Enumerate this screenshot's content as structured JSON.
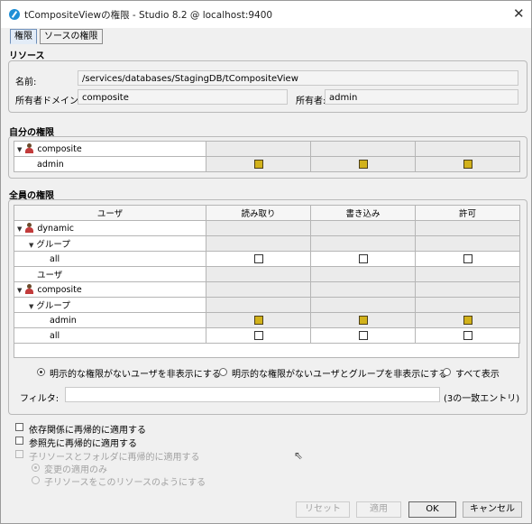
{
  "window": {
    "title": "tCompositeViewの権限 - Studio 8.2 @ localhost:9400"
  },
  "tabs": [
    "権限",
    "ソースの権限"
  ],
  "resource": {
    "section_label": "リソース",
    "name_label": "名前:",
    "name_value": "/services/databases/StagingDB/tCompositeView",
    "domain_label": "所有者ドメイン:",
    "domain_value": "composite",
    "owner_label": "所有者:",
    "owner_value": "admin"
  },
  "my_permissions": {
    "section_label": "自分の権限",
    "group_name": "composite",
    "user_name": "admin"
  },
  "all_permissions": {
    "section_label": "全員の権限",
    "columns": [
      "ユーザ",
      "読み取り",
      "書き込み",
      "許可"
    ],
    "rows": [
      {
        "label": "dynamic",
        "type": "domain"
      },
      {
        "label": "グループ",
        "type": "group-header"
      },
      {
        "label": "all",
        "type": "item",
        "checks": [
          false,
          false,
          false
        ]
      },
      {
        "label": "ユーザ",
        "type": "user-header"
      },
      {
        "label": "composite",
        "type": "domain"
      },
      {
        "label": "グループ",
        "type": "group-header"
      },
      {
        "label": "admin",
        "type": "item",
        "checks": [
          true,
          true,
          true
        ]
      },
      {
        "label": "all",
        "type": "item",
        "checks": [
          false,
          false,
          false
        ]
      }
    ],
    "filter_options": [
      "明示的な権限がないユーザを非表示にする",
      "明示的な権限がないユーザとグループを非表示にする",
      "すべて表示"
    ],
    "selected_filter": 0,
    "filter_label": "フィルタ:",
    "filter_value": "",
    "filter_count": "(3の一致エントリ)"
  },
  "options": {
    "apply_dependencies": "依存関係に再帰的に適用する",
    "apply_references": "参照先に再帰的に適用する",
    "apply_children": "子リソースとフォルダに再帰的に適用する",
    "change_only": "変更の適用のみ",
    "make_like": "子リソースをこのリソースのようにする"
  },
  "buttons": {
    "reset": "リセット",
    "apply": "適用",
    "ok": "OK",
    "cancel": "キャンセル"
  },
  "colors": {
    "checked_fill": "#d2b21b",
    "tab_active": "#e3ecf7"
  }
}
